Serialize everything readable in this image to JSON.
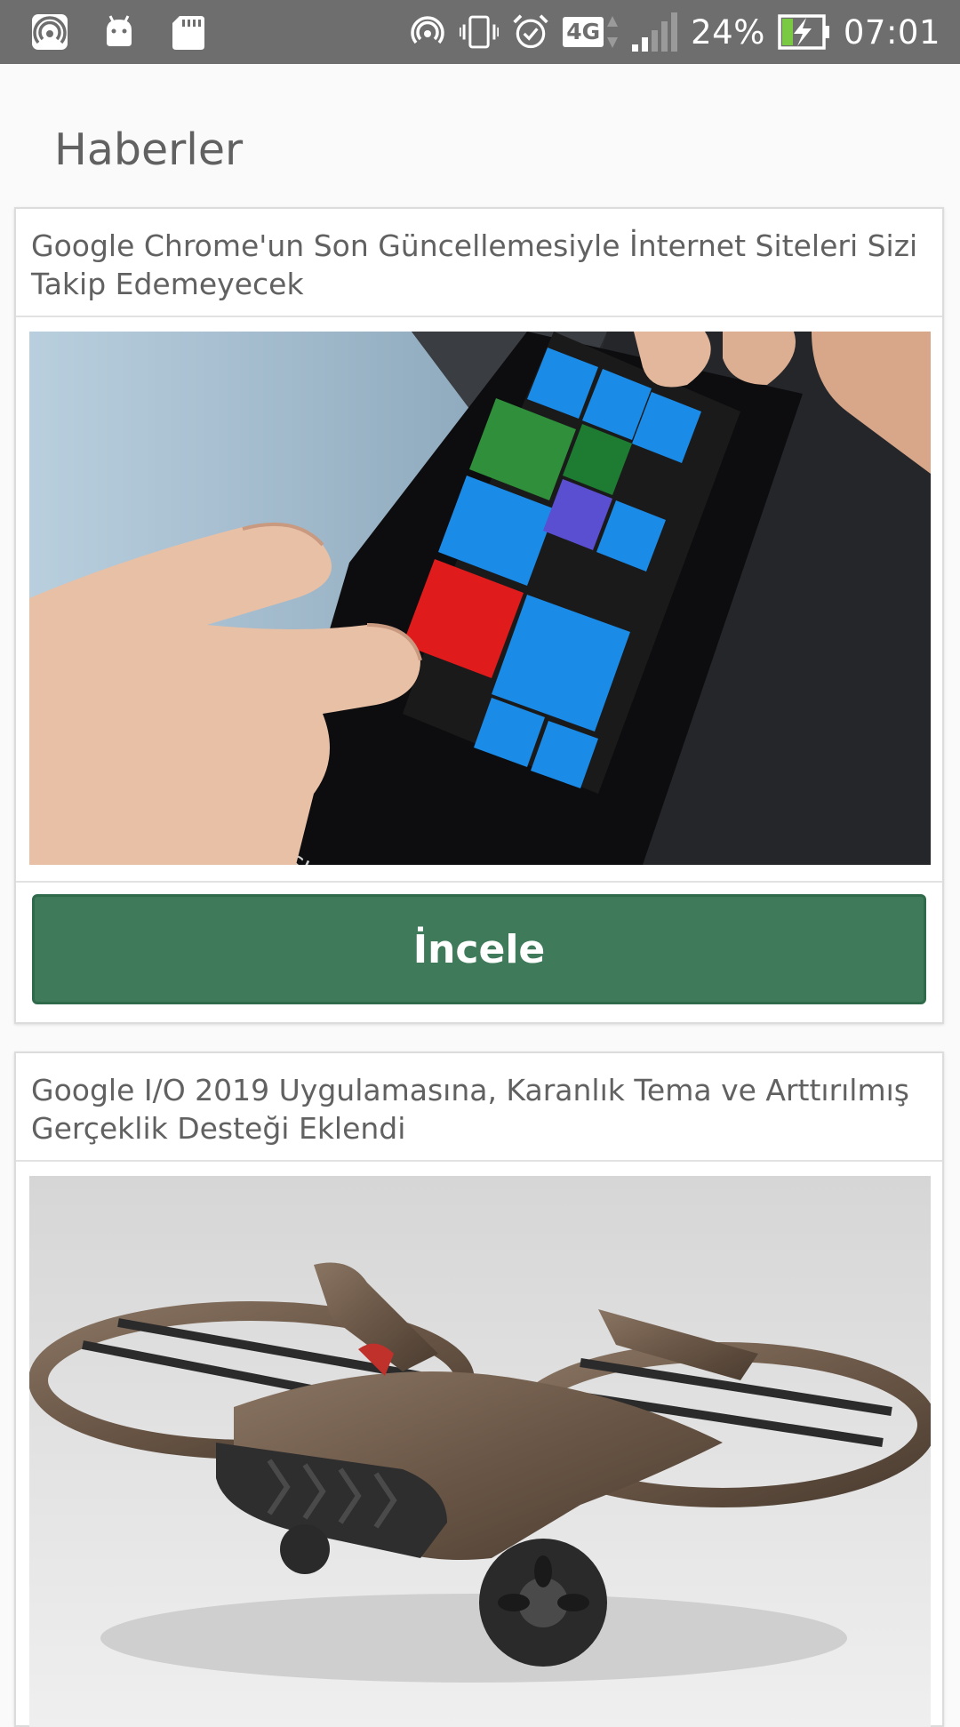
{
  "status_bar": {
    "icons_left": [
      "hotspot-icon",
      "android-icon",
      "sd-card-icon"
    ],
    "icons_right": [
      "hotspot-icon",
      "vibrate-icon",
      "alarm-icon"
    ],
    "network": "4G",
    "battery": "24%",
    "time": "07:01"
  },
  "page": {
    "title": "Haberler"
  },
  "news": [
    {
      "title": "Google Chrome'un Son Güncellemesiyle İnternet Siteleri Sizi Takip Edemeyecek",
      "image": "flexible-phone-image",
      "button_label": "İncele"
    },
    {
      "title": "Google I/O 2019 Uygulamasına, Karanlık Tema ve Arttırılmış Gerçeklik Desteği Eklendi",
      "image": "hover-bike-image"
    }
  ],
  "colors": {
    "status_bar": "#6e6e6e",
    "button": "#3f7a5b",
    "background": "#fafafa"
  }
}
